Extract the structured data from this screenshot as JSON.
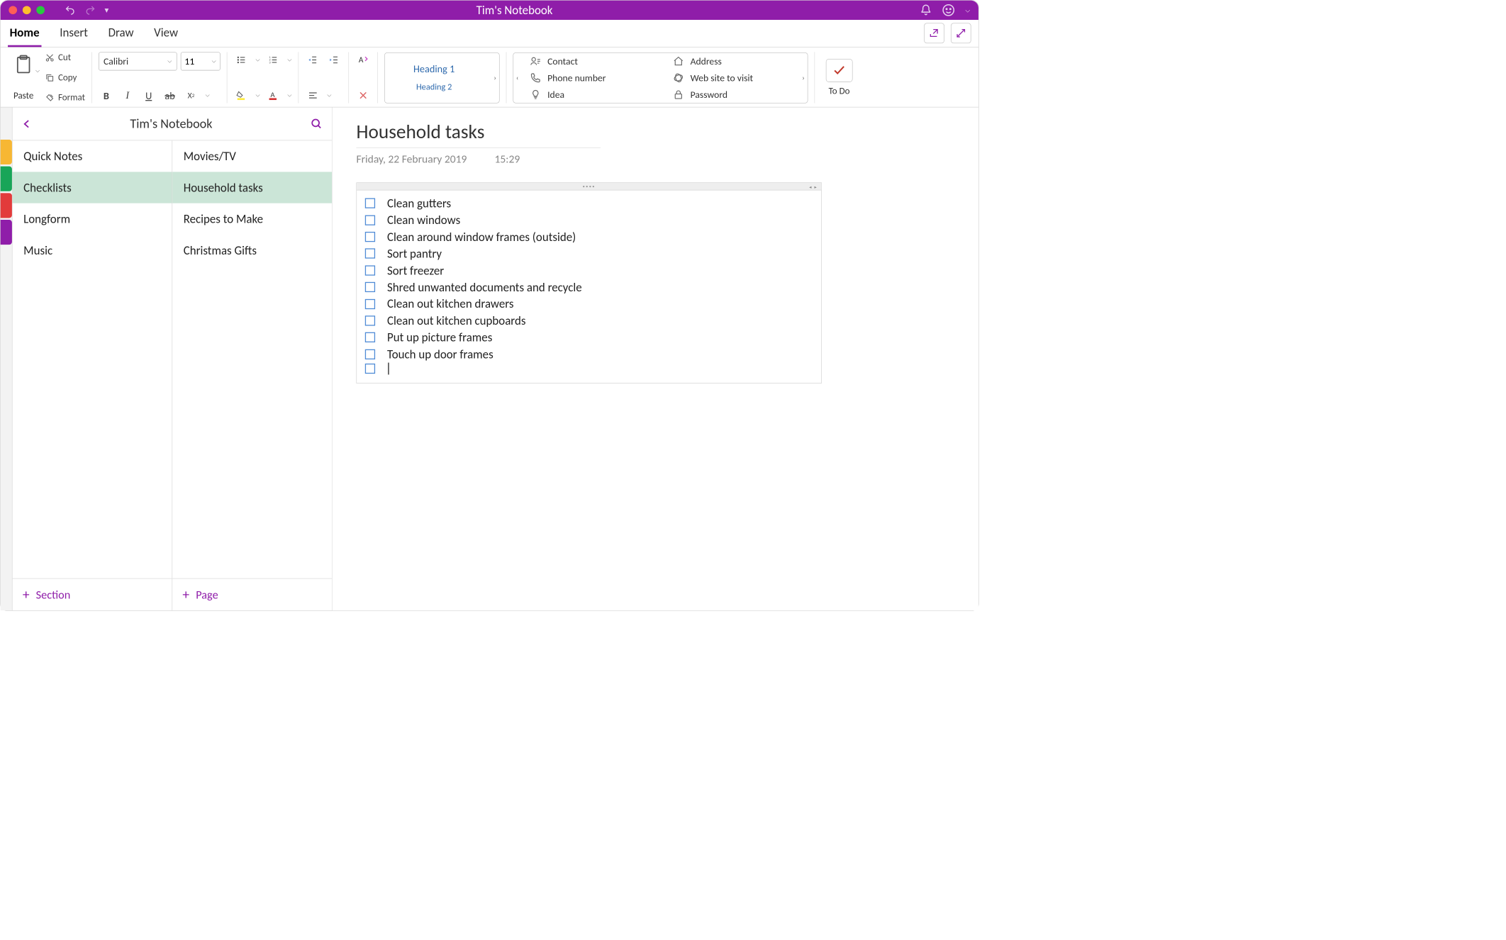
{
  "window": {
    "title": "Tim's Notebook"
  },
  "tabs": {
    "items": [
      "Home",
      "Insert",
      "Draw",
      "View"
    ],
    "active": 0
  },
  "ribbon": {
    "clipboard": {
      "paste": "Paste",
      "cut": "Cut",
      "copy": "Copy",
      "format": "Format"
    },
    "font": {
      "name": "Calibri",
      "size": "11"
    },
    "styles": {
      "h1": "Heading 1",
      "h2": "Heading 2"
    },
    "tags": {
      "col1": [
        {
          "icon": "contact-icon",
          "label": "Contact"
        },
        {
          "icon": "phone-icon",
          "label": "Phone number"
        },
        {
          "icon": "idea-icon",
          "label": "Idea"
        }
      ],
      "col2": [
        {
          "icon": "home-icon",
          "label": "Address"
        },
        {
          "icon": "link-icon",
          "label": "Web site to visit"
        },
        {
          "icon": "lock-icon",
          "label": "Password"
        }
      ]
    },
    "todo": "To Do"
  },
  "nav": {
    "title": "Tim's Notebook",
    "sections": [
      "Quick Notes",
      "Checklists",
      "Longform",
      "Music"
    ],
    "section_selected": 1,
    "pages": [
      "Movies/TV",
      "Household tasks",
      "Recipes to Make",
      "Christmas Gifts"
    ],
    "page_selected": 1,
    "add_section": "Section",
    "add_page": "Page"
  },
  "page": {
    "title": "Household tasks",
    "date": "Friday, 22 February 2019",
    "time": "15:29",
    "tasks": [
      "Clean gutters",
      "Clean windows",
      "Clean around window frames (outside)",
      "Sort pantry",
      "Sort freezer",
      "Shred unwanted documents and recycle",
      "Clean out kitchen drawers",
      "Clean out kitchen cupboards",
      "Put up picture frames",
      "Touch up door frames"
    ]
  }
}
